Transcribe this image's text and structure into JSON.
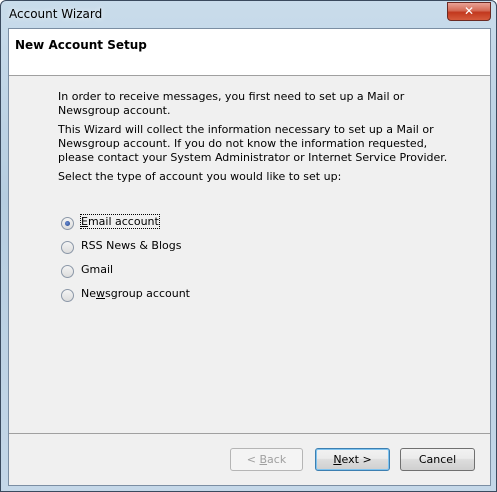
{
  "window": {
    "title": "Account Wizard",
    "close_glyph": "✕"
  },
  "header": {
    "title": "New Account Setup"
  },
  "intro": {
    "p1": "In order to receive messages, you first need to set up a Mail or Newsgroup account.",
    "p2": "This Wizard will collect the information necessary to set up a Mail or Newsgroup account. If you do not know the information requested, please contact your System Administrator or Internet Service Provider.",
    "prompt": "Select the type of account you would like to set up:"
  },
  "options": {
    "selected": "Email account",
    "items": [
      {
        "pre": "",
        "key": "E",
        "post": "mail account",
        "checked": true
      },
      {
        "pre": "RSS News & Blogs",
        "key": "",
        "post": "",
        "checked": false
      },
      {
        "pre": "Gmail",
        "key": "",
        "post": "",
        "checked": false
      },
      {
        "pre": "Ne",
        "key": "w",
        "post": "sgroup account",
        "checked": false
      }
    ]
  },
  "buttons": {
    "back": {
      "pre": "< ",
      "key": "B",
      "post": "ack",
      "enabled": false
    },
    "next": {
      "pre": "",
      "key": "N",
      "post": "ext >",
      "enabled": true
    },
    "cancel": {
      "pre": "Cancel",
      "key": "",
      "post": "",
      "enabled": true
    }
  }
}
